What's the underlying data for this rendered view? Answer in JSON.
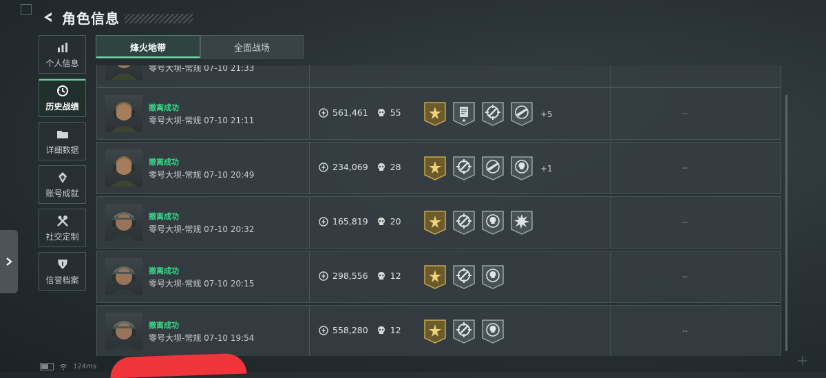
{
  "header": {
    "title": "角色信息"
  },
  "sidebar": {
    "items": [
      {
        "label": "个人信息",
        "icon": "bar-chart-icon",
        "active": false
      },
      {
        "label": "历史战绩",
        "icon": "history-clock-icon",
        "active": true
      },
      {
        "label": "详细数据",
        "icon": "folder-icon",
        "active": false
      },
      {
        "label": "账号成就",
        "icon": "achievement-icon",
        "active": false
      },
      {
        "label": "社交定制",
        "icon": "tools-icon",
        "active": false
      },
      {
        "label": "信誉档案",
        "icon": "reputation-shield-icon",
        "active": false
      }
    ]
  },
  "tabs": [
    {
      "label": "烽火地带",
      "active": true
    },
    {
      "label": "全面战场",
      "active": false
    }
  ],
  "partial_row": {
    "meta": "零号大坝-常规 07-10 21:33"
  },
  "records": [
    {
      "status": "撤离成功",
      "meta": "零号大坝-常规 07-10 21:11",
      "value": "561,461",
      "kills": "55",
      "badges": [
        "gold-star-badge-icon",
        "document-badge-icon",
        "crosshair-badge-icon",
        "gun-badge-icon"
      ],
      "more": "+5",
      "extra": "--"
    },
    {
      "status": "撤离成功",
      "meta": "零号大坝-常规 07-10 20:49",
      "value": "234,069",
      "kills": "28",
      "badges": [
        "gold-star-badge-icon",
        "crosshair-badge-icon",
        "gun-badge-icon",
        "skull-target-badge-icon"
      ],
      "more": "+1",
      "extra": "--"
    },
    {
      "status": "撤离成功",
      "meta": "零号大坝-常规 07-10 20:32",
      "value": "165,819",
      "kills": "20",
      "badges": [
        "gold-star-badge-icon",
        "crosshair-badge-icon",
        "skull-target-badge-icon",
        "explosion-badge-icon"
      ],
      "more": "",
      "extra": "--"
    },
    {
      "status": "撤离成功",
      "meta": "零号大坝-常规 07-10 20:15",
      "value": "298,556",
      "kills": "12",
      "badges": [
        "gold-star-badge-icon",
        "crosshair-badge-icon",
        "skull-target-badge-icon"
      ],
      "more": "",
      "extra": "--"
    },
    {
      "status": "撤离成功",
      "meta": "零号大坝-常规 07-10 19:54",
      "value": "558,280",
      "kills": "12",
      "badges": [
        "gold-star-badge-icon",
        "crosshair-badge-icon",
        "skull-target-badge-icon"
      ],
      "more": "",
      "extra": "--"
    }
  ],
  "footer": {
    "ping": "124ms"
  },
  "colors": {
    "accent": "#38d98a",
    "gold": "#c9a84a"
  }
}
